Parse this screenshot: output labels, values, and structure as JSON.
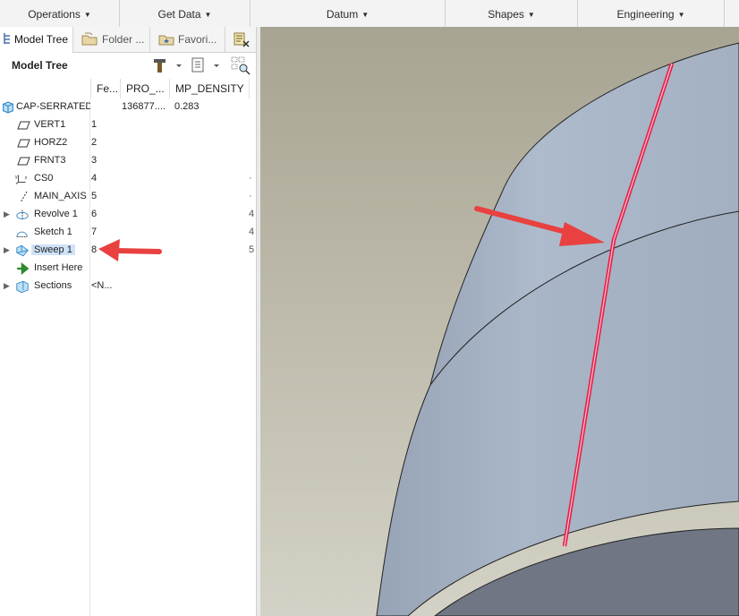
{
  "ribbon": {
    "groups": [
      "Operations",
      "Get Data",
      "Datum",
      "Shapes",
      "Engineering"
    ]
  },
  "navigator": {
    "tabs": [
      "Model Tree",
      "Folder ...",
      "Favori..."
    ]
  },
  "model_tree": {
    "title": "Model Tree",
    "columns": [
      "Fe...",
      "PRO_...",
      "MP_DENSITY"
    ],
    "root": {
      "name": "CAP-SERRATED.F",
      "pro": "136877....",
      "density": "0.283"
    },
    "rows": [
      {
        "name": "VERT1",
        "num": "1",
        "edge": ""
      },
      {
        "name": "HORZ2",
        "num": "2",
        "edge": ""
      },
      {
        "name": "FRNT3",
        "num": "3",
        "edge": ""
      },
      {
        "name": "CS0",
        "num": "4",
        "edge": "·"
      },
      {
        "name": "MAIN_AXIS",
        "num": "5",
        "edge": "·"
      },
      {
        "name": "Revolve 1",
        "num": "6",
        "edge": "4"
      },
      {
        "name": "Sketch 1",
        "num": "7",
        "edge": "4"
      },
      {
        "name": "Sweep 1",
        "num": "8",
        "edge": "5"
      },
      {
        "name": "Insert Here",
        "num": "",
        "edge": ""
      },
      {
        "name": "Sections",
        "num": "<N...",
        "edge": ""
      }
    ]
  },
  "colors": {
    "background_top": "#a8a493",
    "background_bottom": "#d4d2c6",
    "part_face": "#a5b2c3",
    "highlight": "#e8204a",
    "arrow": "#e8413f",
    "selection": "#cfe3f8"
  }
}
